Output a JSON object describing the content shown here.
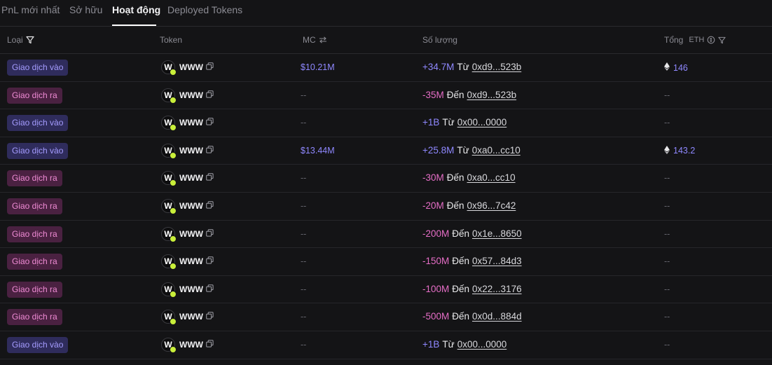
{
  "tabs": [
    {
      "label": "PnL mới nhất",
      "active": false
    },
    {
      "label": "Sở hữu",
      "active": false
    },
    {
      "label": "Hoạt động",
      "active": true
    },
    {
      "label": "Deployed Tokens",
      "active": false
    }
  ],
  "columns": {
    "type": "Loại",
    "token": "Token",
    "mc": "MC",
    "quantity": "Số lượng",
    "total": "Tổng",
    "total_unit": "ETH"
  },
  "colors": {
    "in": "#a59cff",
    "out": "#f08bd5",
    "plus": "#8f88ff",
    "minus": "#e66ec7"
  },
  "rows": [
    {
      "type": "Giao dịch vào",
      "kind": "in",
      "token": "WWW",
      "avatar": "W",
      "mc": "$10.21M",
      "amount": "+34.7M",
      "sign": "plus",
      "dir": "Từ",
      "addr": "0xd9...523b",
      "total": "146"
    },
    {
      "type": "Giao dịch ra",
      "kind": "out",
      "token": "WWW",
      "avatar": "W",
      "mc": "--",
      "amount": "-35M",
      "sign": "minus",
      "dir": "Đến",
      "addr": "0xd9...523b",
      "total": "--"
    },
    {
      "type": "Giao dịch vào",
      "kind": "in",
      "token": "WWW",
      "avatar": "W",
      "mc": "--",
      "amount": "+1B",
      "sign": "plus",
      "dir": "Từ",
      "addr": "0x00...0000",
      "total": "--"
    },
    {
      "type": "Giao dịch vào",
      "kind": "in",
      "token": "WWW",
      "avatar": "W",
      "mc": "$13.44M",
      "amount": "+25.8M",
      "sign": "plus",
      "dir": "Từ",
      "addr": "0xa0...cc10",
      "total": "143.2"
    },
    {
      "type": "Giao dịch ra",
      "kind": "out",
      "token": "WWW",
      "avatar": "W",
      "mc": "--",
      "amount": "-30M",
      "sign": "minus",
      "dir": "Đến",
      "addr": "0xa0...cc10",
      "total": "--"
    },
    {
      "type": "Giao dịch ra",
      "kind": "out",
      "token": "WWW",
      "avatar": "W",
      "mc": "--",
      "amount": "-20M",
      "sign": "minus",
      "dir": "Đến",
      "addr": "0x96...7c42",
      "total": "--"
    },
    {
      "type": "Giao dịch ra",
      "kind": "out",
      "token": "WWW",
      "avatar": "W",
      "mc": "--",
      "amount": "-200M",
      "sign": "minus",
      "dir": "Đến",
      "addr": "0x1e...8650",
      "total": "--"
    },
    {
      "type": "Giao dịch ra",
      "kind": "out",
      "token": "WWW",
      "avatar": "W",
      "mc": "--",
      "amount": "-150M",
      "sign": "minus",
      "dir": "Đến",
      "addr": "0x57...84d3",
      "total": "--"
    },
    {
      "type": "Giao dịch ra",
      "kind": "out",
      "token": "WWW",
      "avatar": "W",
      "mc": "--",
      "amount": "-100M",
      "sign": "minus",
      "dir": "Đến",
      "addr": "0x22...3176",
      "total": "--"
    },
    {
      "type": "Giao dịch ra",
      "kind": "out",
      "token": "WWW",
      "avatar": "W",
      "mc": "--",
      "amount": "-500M",
      "sign": "minus",
      "dir": "Đến",
      "addr": "0x0d...884d",
      "total": "--"
    },
    {
      "type": "Giao dịch vào",
      "kind": "in",
      "token": "WWW",
      "avatar": "W",
      "mc": "--",
      "amount": "+1B",
      "sign": "plus",
      "dir": "Từ",
      "addr": "0x00...0000",
      "total": "--"
    }
  ]
}
